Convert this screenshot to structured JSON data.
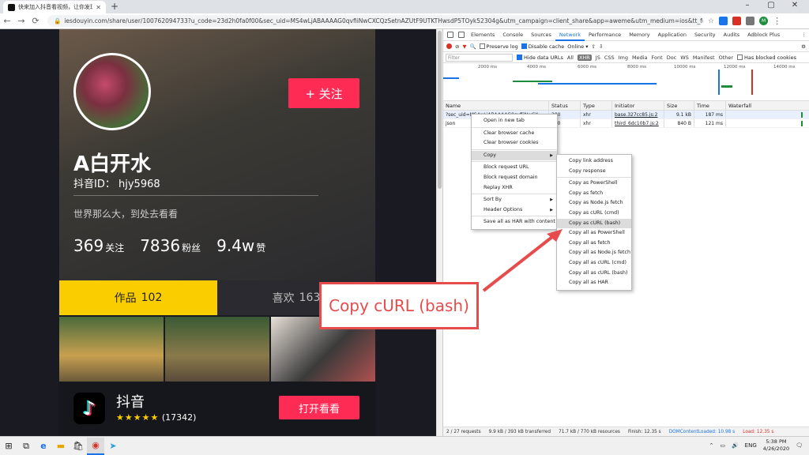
{
  "browser": {
    "tab_title": "快来加入抖音看视频，让你发现…",
    "new_tab": "+",
    "url": "iesdouyin.com/share/user/100762094733?u_code=23d2h0fa0f00&sec_uid=MS4wLjABAAAAG0qvfiiNwCXCQzSetnAZUtF9UTKTHwsdP5TOyk52304g&utm_campaign=client_share&app=aweme&utm_medium=ios&tt_from=copy&utm_source=copy",
    "window_controls": [
      "–",
      "▢",
      "✕"
    ],
    "profile_initial": "M"
  },
  "profile": {
    "follow_label": "+ 关注",
    "name": "A白开水",
    "id_label": "抖音ID：",
    "id_value": "hjy5968",
    "bio": "世界那么大，到处去看看",
    "stats": [
      {
        "num": "369",
        "label": "关注"
      },
      {
        "num": "7836",
        "label": "粉丝"
      },
      {
        "num": "9.4w",
        "label": "赞"
      }
    ],
    "tab_works": {
      "label": "作品",
      "count": "102"
    },
    "tab_likes": {
      "label": "喜欢",
      "count": "163"
    }
  },
  "app_banner": {
    "logo": "♪",
    "name": "抖音",
    "stars": "★★★★★",
    "rating_count": "(17342)",
    "open_label": "打开看看"
  },
  "devtools": {
    "tabs": [
      "Elements",
      "Console",
      "Sources",
      "Network",
      "Performance",
      "Memory",
      "Application",
      "Security",
      "Audits",
      "Adblock Plus"
    ],
    "active_tab": "Network",
    "controls": {
      "preserve_log": "Preserve log",
      "disable_cache": "Disable cache",
      "throttle": "Online ▾"
    },
    "filter_placeholder": "Filter",
    "hide_data_urls": "Hide data URLs",
    "types": [
      "All",
      "XHR",
      "JS",
      "CSS",
      "Img",
      "Media",
      "Font",
      "Doc",
      "WS",
      "Manifest",
      "Other"
    ],
    "has_blocked": "Has blocked cookies",
    "overview_ticks": [
      "2000 ms",
      "4000 ms",
      "6000 ms",
      "8000 ms",
      "10000 ms",
      "12000 ms",
      "14000 ms"
    ],
    "columns": [
      "Name",
      "Status",
      "Type",
      "Initiator",
      "Size",
      "Time",
      "Waterfall"
    ],
    "rows": [
      {
        "name": "?sec_uid=MS4wLjABAAAAG0qvfiiNwCX",
        "status": "200",
        "type": "xhr",
        "initiator": "base.327cc85.js:2",
        "size": "9.1 kB",
        "time": "187 ms"
      },
      {
        "name": "json",
        "status": "200",
        "type": "xhr",
        "initiator": "third_6dc10b7.js:2",
        "size": "840 B",
        "time": "121 ms"
      }
    ],
    "status_bar": {
      "requests": "2 / 27 requests",
      "transferred": "9.9 kB / 393 kB transferred",
      "resources": "71.7 kB / 770 kB resources",
      "finish": "Finish: 12.35 s",
      "dcl": "DOMContentLoaded: 10.98 s",
      "load": "Load: 12.35 s"
    }
  },
  "context_menu": [
    {
      "label": "Open in new tab"
    },
    {
      "sep": true
    },
    {
      "label": "Clear browser cache"
    },
    {
      "label": "Clear browser cookies"
    },
    {
      "sep": true
    },
    {
      "label": "Copy",
      "submenu": true,
      "highlight": true
    },
    {
      "sep": true
    },
    {
      "label": "Block request URL"
    },
    {
      "label": "Block request domain"
    },
    {
      "label": "Replay XHR"
    },
    {
      "sep": true
    },
    {
      "label": "Sort By",
      "submenu": true
    },
    {
      "label": "Header Options",
      "submenu": true
    },
    {
      "sep": true
    },
    {
      "label": "Save all as HAR with content"
    }
  ],
  "copy_submenu": [
    {
      "label": "Copy link address"
    },
    {
      "label": "Copy response"
    },
    {
      "sep": true
    },
    {
      "label": "Copy as PowerShell"
    },
    {
      "label": "Copy as fetch"
    },
    {
      "label": "Copy as Node.js fetch"
    },
    {
      "label": "Copy as cURL (cmd)"
    },
    {
      "label": "Copy as cURL (bash)",
      "highlight": true
    },
    {
      "label": "Copy all as PowerShell"
    },
    {
      "label": "Copy all as fetch"
    },
    {
      "label": "Copy all as Node.js fetch"
    },
    {
      "label": "Copy all as cURL (cmd)"
    },
    {
      "label": "Copy all as cURL (bash)"
    },
    {
      "label": "Copy all as HAR"
    }
  ],
  "callout": "Copy cURL (bash)",
  "taskbar": {
    "lang": "ENG",
    "time": "5:38 PM",
    "date": "4/26/2020"
  },
  "colors": {
    "accent": "#fe2c55",
    "tab_yellow": "#facd00",
    "callout_red": "#e74c4c",
    "devtools_blue": "#1a73e8"
  }
}
